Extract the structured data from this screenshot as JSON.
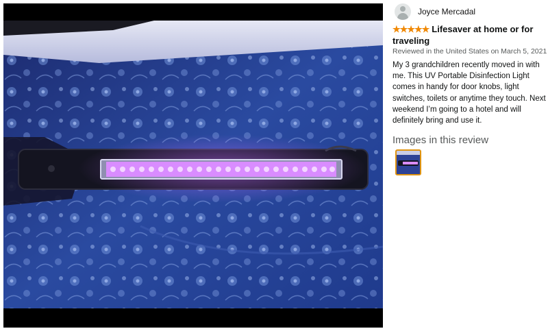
{
  "viewer": {
    "image_alt": "UV portable disinfection light wand shown lit with purple UV LEDs on a blue floral tablecloth"
  },
  "review": {
    "reviewer_name": "Joyce Mercadal",
    "rating": 5,
    "stars_display": "★★★★★",
    "title": "Lifesaver at home or for traveling",
    "meta": "Reviewed in the United States on March 5, 2021",
    "body": "My 3 grandchildren recently moved in with me. This UV Portable Disinfection Light comes in handy for door knobs, light switches, toilets or anytime they touch. Next weekend I’m going to a hotel and will definitely bring and use it.",
    "images_heading": "Images in this review"
  },
  "colors": {
    "star": "#f08804",
    "thumb_border": "#e09410",
    "uv_glow": "#c06cff"
  }
}
